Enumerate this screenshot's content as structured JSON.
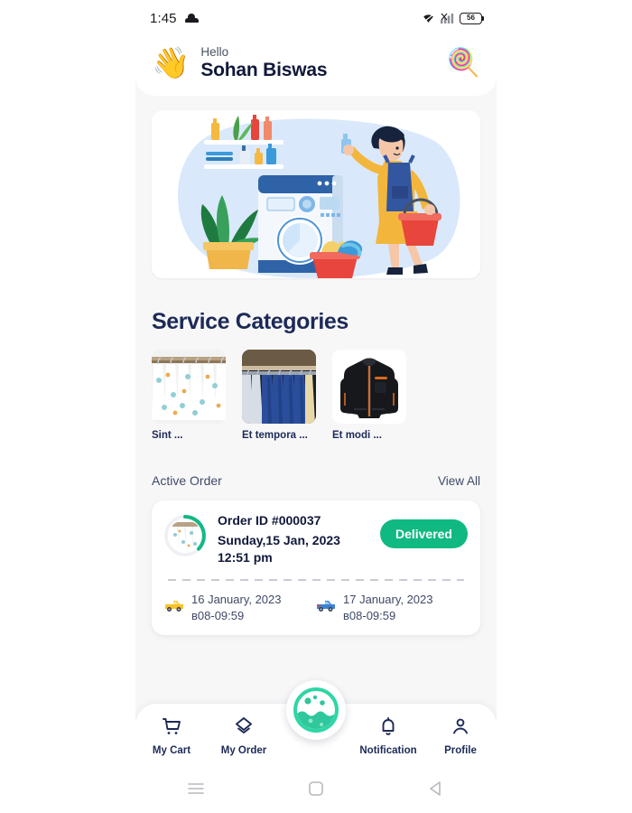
{
  "status_bar": {
    "time": "1:45",
    "weather_icon": "cloud-icon",
    "wifi_icon": "wifi-icon",
    "signal_icon": "signal-bars-icon",
    "battery_level": "56"
  },
  "header": {
    "wave_icon": "waving-hand-emoji",
    "wave_glyph": "👋",
    "hello_label": "Hello",
    "user_name": "Sohan Biswas",
    "reward_icon": "lollipop-emoji",
    "reward_glyph": "🍭"
  },
  "hero": {
    "alt": "laundry-illustration-woman-with-washing-machine"
  },
  "categories_section": {
    "title": "Service Categories",
    "items": [
      {
        "label": "Sint ...",
        "image": "clothes-rack-patterned-shirts"
      },
      {
        "label": "Et tempora ...",
        "image": "blue-suits-on-hangers"
      },
      {
        "label": "Et modi ...",
        "image": "black-jacket"
      }
    ]
  },
  "active_order": {
    "title": "Active Order",
    "view_all_label": "View All",
    "card": {
      "thumbnail_icon": "order-thumbnail-with-progress-ring",
      "order_id": "Order ID #000037",
      "date": "Sunday,15 Jan, 2023",
      "time": "12:51 pm",
      "status": "Delivered",
      "status_color": "#10b981",
      "pickup": {
        "icon": "pickup-truck-yellow-emoji",
        "glyph": "🚚",
        "date": "16 January, 2023",
        "time": "ʙ08-09:59"
      },
      "delivery": {
        "icon": "pickup-truck-blue-emoji",
        "glyph": "🚚",
        "date": "17 January, 2023",
        "time": "ʙ08-09:59"
      }
    }
  },
  "bottom_nav": {
    "items": [
      {
        "label": "My Cart",
        "icon": "shopping-cart-icon"
      },
      {
        "label": "My Order",
        "icon": "layers-diamond-icon"
      },
      {
        "label": "Notification",
        "icon": "bell-icon"
      },
      {
        "label": "Profile",
        "icon": "person-icon"
      }
    ],
    "fab_icon": "washing-bubbles-icon",
    "accent_color": "#2fd6a5"
  },
  "android_nav": {
    "menu_icon": "hamburger-menu-icon",
    "home_icon": "home-square-icon",
    "back_icon": "back-triangle-icon"
  }
}
